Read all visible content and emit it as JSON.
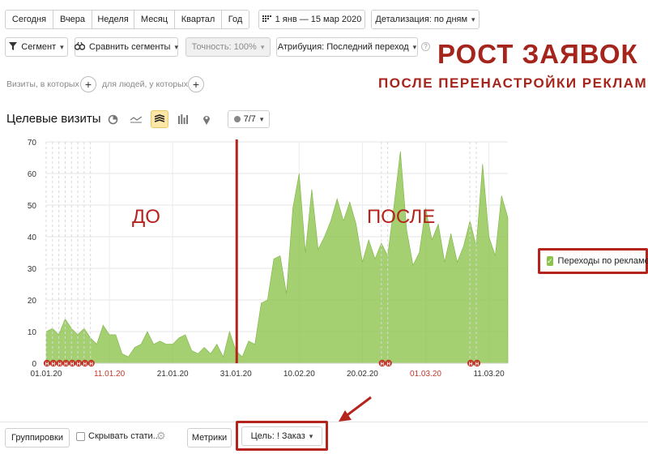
{
  "period_buttons": [
    "Сегодня",
    "Вчера",
    "Неделя",
    "Месяц",
    "Квартал",
    "Год"
  ],
  "date_range": "1 янв — 15 мар 2020",
  "detail": "Детализация: по дням",
  "toolbar": {
    "segment": "Сегмент",
    "compare": "Сравнить сегменты",
    "accuracy": "Точность: 100%",
    "attribution": "Атрибуция: Последний переход"
  },
  "filters": {
    "visits_label": "Визиты, в которых",
    "people_label": "для людей, у которых"
  },
  "headline": {
    "line1": "РОСТ ЗАЯВОК",
    "line2": "ПОСЛЕ ПЕРЕНАСТРОЙКИ РЕКЛАМЫ"
  },
  "chart_title": "Целевые визиты",
  "series_count": "7/7",
  "legend": {
    "label": "Переходы по рекламе",
    "color": "#8bc34a"
  },
  "chart_data": {
    "type": "area",
    "title": "",
    "xlabel": "",
    "ylabel": "",
    "ylim": [
      0,
      70
    ],
    "y_ticks": [
      0,
      10,
      20,
      30,
      40,
      50,
      60,
      70
    ],
    "x_tick_labels": [
      {
        "label": "01.01.20",
        "holiday": false
      },
      {
        "label": "11.01.20",
        "holiday": true
      },
      {
        "label": "21.01.20",
        "holiday": false
      },
      {
        "label": "31.01.20",
        "holiday": false
      },
      {
        "label": "10.02.20",
        "holiday": false
      },
      {
        "label": "20.02.20",
        "holiday": false
      },
      {
        "label": "01.03.20",
        "holiday": true
      },
      {
        "label": "11.03.20",
        "holiday": false
      }
    ],
    "grid": true,
    "legend_position": "right",
    "annotations": [
      "ДО",
      "ПОСЛЕ"
    ],
    "holiday_marker": "Н",
    "series": [
      {
        "name": "Переходы по рекламе",
        "color": "#8bc34a",
        "values": [
          10,
          11,
          9,
          14,
          11,
          9,
          11,
          8,
          6,
          12,
          9,
          9,
          3,
          2,
          5,
          6,
          10,
          6,
          7,
          6,
          6,
          8,
          9,
          4,
          3,
          5,
          3,
          6,
          2,
          10,
          4,
          2,
          7,
          6,
          19,
          20,
          33,
          34,
          22,
          49,
          60,
          35,
          55,
          36,
          40,
          45,
          52,
          45,
          51,
          44,
          32,
          39,
          33,
          38,
          34,
          50,
          67,
          42,
          31,
          35,
          49,
          39,
          44,
          32,
          41,
          32,
          37,
          45,
          37,
          63,
          40,
          34,
          53,
          46
        ]
      }
    ]
  },
  "bottom": {
    "groupings": "Группировки",
    "hide_stats": "Скрывать стати...",
    "metrics": "Метрики",
    "goal": "Цель: ! Заказ"
  },
  "icons": {
    "calendar": "calendar-icon",
    "filter": "filter-icon",
    "compare": "compare-icon",
    "help": "help-icon",
    "gear": "gear-icon",
    "pie": "pie-chart-icon",
    "line": "line-chart-icon",
    "area": "area-chart-icon",
    "bar": "bar-chart-icon",
    "map": "map-pin-icon"
  },
  "colors": {
    "accent_red": "#a5251c",
    "divider_red": "#b4241c",
    "area_green": "#8bc34a",
    "holiday_red": "#c0392b"
  }
}
